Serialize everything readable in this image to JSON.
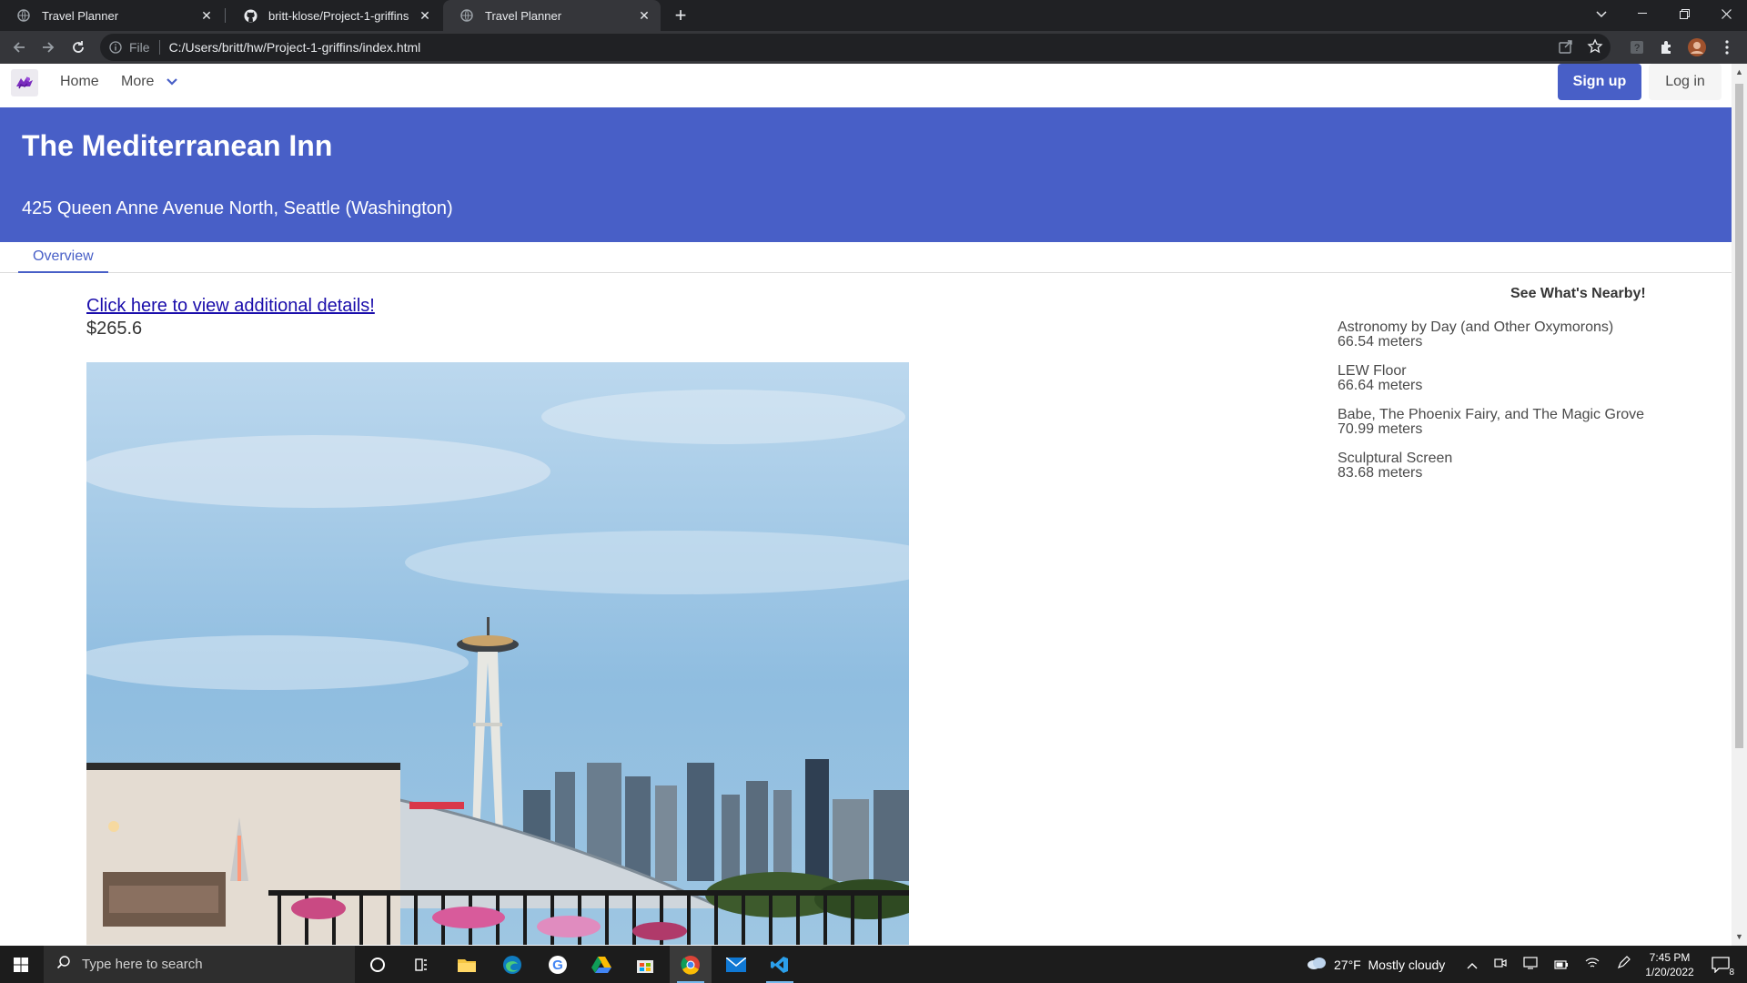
{
  "browser": {
    "tabs": [
      {
        "title": "Travel Planner",
        "active": false
      },
      {
        "title": "britt-klose/Project-1-griffins",
        "active": false
      },
      {
        "title": "Travel Planner",
        "active": true
      }
    ],
    "omnibox": {
      "scheme_label": "File",
      "url": "C:/Users/britt/hw/Project-1-griffins/index.html"
    }
  },
  "navbar": {
    "home_label": "Home",
    "more_label": "More",
    "signup_label": "Sign up",
    "login_label": "Log in"
  },
  "hero": {
    "title": "The Mediterranean Inn",
    "address": "425 Queen Anne Avenue North, Seattle (Washington)"
  },
  "tabs": {
    "overview_label": "Overview"
  },
  "main": {
    "details_link": "Click here to view additional details!",
    "price": "$265.6"
  },
  "nearby": {
    "title": "See What's Nearby!",
    "items": [
      {
        "name": "Astronomy by Day (and Other Oxymorons)",
        "distance": "66.54 meters"
      },
      {
        "name": "LEW Floor",
        "distance": "66.64 meters"
      },
      {
        "name": "Babe, The Phoenix Fairy, and The Magic Grove",
        "distance": "70.99 meters"
      },
      {
        "name": "Sculptural Screen",
        "distance": "83.68 meters"
      }
    ]
  },
  "taskbar": {
    "search_placeholder": "Type here to search",
    "weather": "27°F  Mostly cloudy",
    "time": "7:45 PM",
    "date": "1/20/2022",
    "notification_count": "8"
  },
  "colors": {
    "primary": "#485fc7",
    "browser_dark": "#202124",
    "taskbar": "#1c1c1c"
  }
}
